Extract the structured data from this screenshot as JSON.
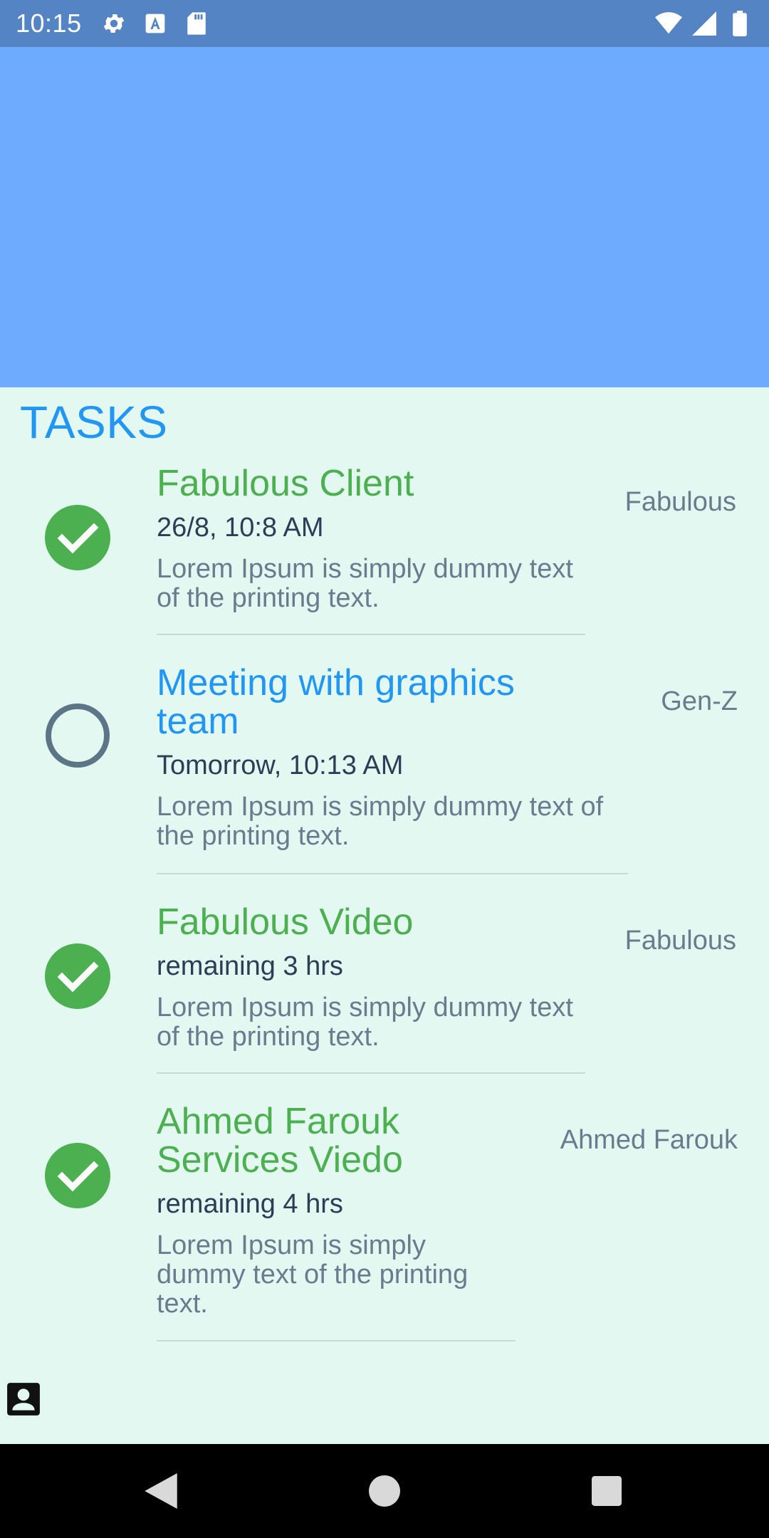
{
  "status_bar": {
    "time": "10:15",
    "left_icons": [
      "gear-icon",
      "text-a-icon",
      "sd-card-icon"
    ],
    "right_icons": [
      "wifi-icon",
      "signal-icon",
      "battery-icon"
    ]
  },
  "tasks_title": "TASKS",
  "tasks": [
    {
      "title": "Fabulous Client",
      "when": "26/8, 10:8 AM",
      "description": "Lorem Ipsum is simply dummy text of the printing text.",
      "client": "Fabulous",
      "completed": true
    },
    {
      "title": "Meeting with graphics team",
      "when": "Tomorrow, 10:13 AM",
      "description": "Lorem Ipsum is simply dummy text of the printing text.",
      "client": "Gen-Z",
      "completed": false
    },
    {
      "title": "Fabulous Video",
      "when": "remaining 3 hrs",
      "description": "Lorem Ipsum is simply dummy text of the printing text.",
      "client": "Fabulous",
      "completed": true
    },
    {
      "title": "Ahmed Farouk Services Viedo",
      "when": "remaining 4 hrs",
      "description": "Lorem Ipsum is simply dummy text of the printing text.",
      "client": "Ahmed Farouk",
      "completed": true
    }
  ],
  "colors": {
    "status_bar": "#5484c4",
    "header": "#6eabff",
    "background": "#e3f8f1",
    "accent_blue": "#2196f3",
    "done_green": "#4caf50"
  },
  "nav": {
    "back": "back-icon",
    "home": "home-icon",
    "recents": "recents-icon"
  }
}
